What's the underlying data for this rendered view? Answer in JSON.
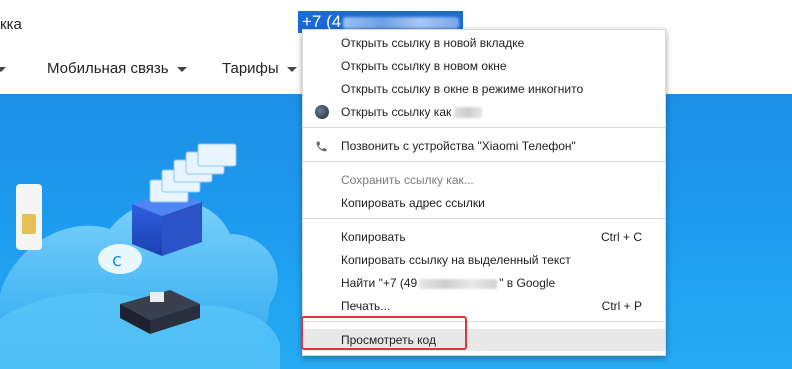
{
  "header": {
    "title": "кка",
    "phone_link": "+7 (4"
  },
  "nav": [
    {
      "label": "Мобильная связь"
    },
    {
      "label": "Тарифы"
    }
  ],
  "context_menu": {
    "items": [
      {
        "label": "Открыть ссылку в новой вкладке"
      },
      {
        "label": "Открыть ссылку в новом окне"
      },
      {
        "label": "Открыть ссылку в окне в режиме инкогнито"
      },
      {
        "label": "Открыть ссылку как",
        "icon": "profile-avatar-icon"
      },
      {
        "label": "Позвонить с устройства \"Xiaomi Телефон\"",
        "icon": "phone-icon"
      },
      {
        "label": "Сохранить ссылку как...",
        "disabled": true
      },
      {
        "label": "Копировать адрес ссылки"
      },
      {
        "label": "Копировать",
        "shortcut": "Ctrl + C"
      },
      {
        "label": "Копировать ссылку на выделенный текст"
      },
      {
        "label_prefix": "Найти \"+7 (49",
        "label_suffix": "\" в Google"
      },
      {
        "label": "Печать...",
        "shortcut": "Ctrl + P"
      },
      {
        "label": "Просмотреть код",
        "highlighted": true
      }
    ]
  },
  "colors": {
    "banner": "#1d9bef",
    "highlight_border": "#e0353a",
    "link_selection": "#1a6ad8"
  }
}
